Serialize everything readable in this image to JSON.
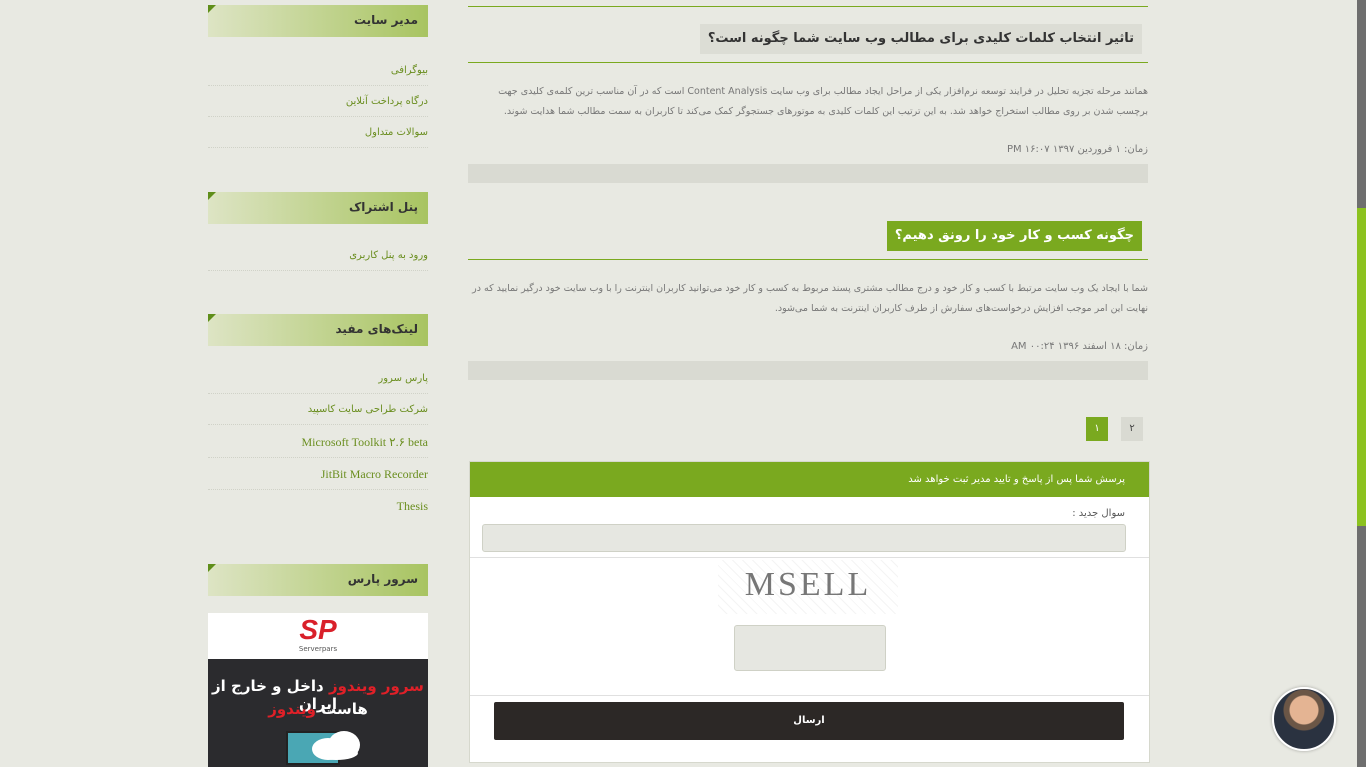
{
  "sidebar": {
    "admin": {
      "title": "مدیر سایت",
      "links": [
        "بیوگرافی",
        "درگاه پرداخت آنلاین",
        "سوالات متداول"
      ]
    },
    "panel": {
      "title": "پنل اشتراک",
      "links": [
        "ورود به پنل کاربری"
      ]
    },
    "useful": {
      "title": "لینک‌های مفید",
      "links": [
        "پارس سرور",
        "شرکت طراحی سایت کاسپید",
        "Microsoft Toolkit ۲.۶ beta",
        "JitBit Macro Recorder",
        "Thesis"
      ]
    },
    "pars": {
      "title": "سرور پارس"
    }
  },
  "ad": {
    "logo_text": "SP",
    "brand": "Serverpars",
    "line1_red": "سرور ویندوز",
    "line1_white": " داخل و خارج از ایران",
    "line2_white": "هاست ",
    "line2_red": "ویندوز"
  },
  "posts": [
    {
      "title": "تاثیر انتخاب کلمات کلیدی برای مطالب وب سایت شما چگونه است؟",
      "body": "همانند مرحله تجزیه تحلیل در فرایند توسعه نرم‌افزار یکی از مراحل ایجاد مطالب برای وب سایت Content Analysis است که در آن مناسب ترین کلمه‌ی کلیدی جهت برچسب شدن بر روی مطالب استخراج خواهد شد. به این ترتیب این کلمات کلیدی به موتورهای جستجوگر کمک می‌کند تا کاربران به سمت مطالب شما هدایت شوند.",
      "date": "زمان: ۱ فروردین ۱۳۹۷ ۱۶:۰۷ PM"
    },
    {
      "title": "چگونه کسب و کار خود را رونق دهیم؟",
      "body": "شما با ایجاد یک وب سایت مرتبط با کسب و کار خود و درج مطالب مشتری پسند مربوط به کسب و کار خود می‌توانید کاربران اینترنت را با وب سایت خود درگیر نمایید که در نهایت این امر موجب افزایش درخواست‌های سفارش از طرف کاربران اینترنت به شما می‌شود.",
      "date": "زمان: ۱۸ اسفند ۱۳۹۶ ۰۰:۲۴ AM"
    }
  ],
  "pagination": {
    "current": "۱",
    "next": "۲"
  },
  "form": {
    "header": "پرسش شما پس از پاسخ و تایید مدیر ثبت خواهد شد",
    "question_label": "سوال جدید :",
    "captcha_text": "MSELL",
    "submit": "ارسال"
  },
  "colors": {
    "accent": "#7aa91f",
    "bg": "#e8e9e2",
    "dark_button": "#2c2826"
  }
}
